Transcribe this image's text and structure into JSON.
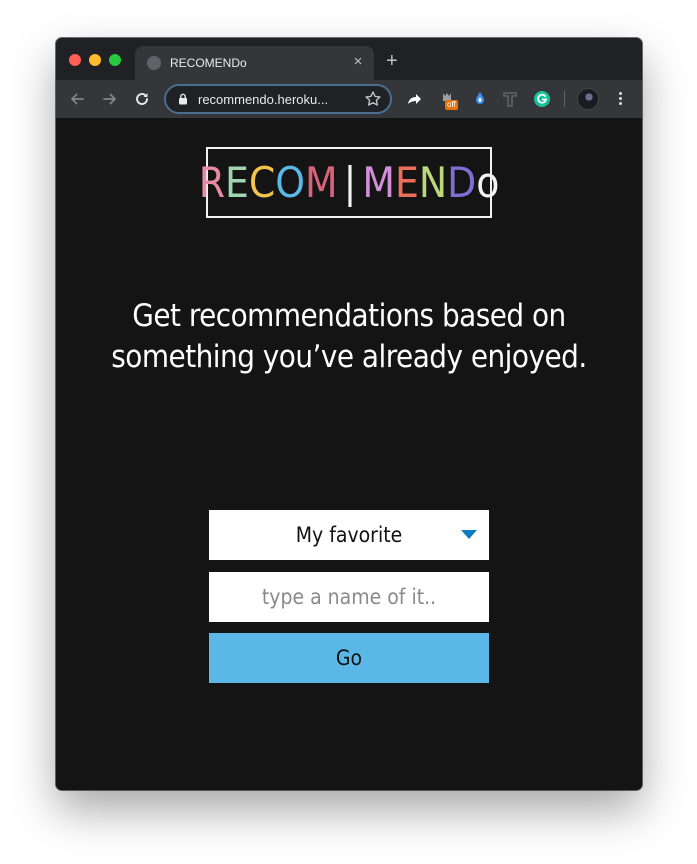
{
  "browser": {
    "tab_title": "RECOMENDo",
    "tab_close": "×",
    "new_tab": "+",
    "url": "recommendo.heroku...",
    "extension_badge": "off"
  },
  "logo": {
    "letters": [
      {
        "char": "R",
        "color": "#e88aa6"
      },
      {
        "char": "E",
        "color": "#9fd6b0"
      },
      {
        "char": "C",
        "color": "#f3c24b"
      },
      {
        "char": "O",
        "color": "#59b8e6"
      },
      {
        "char": "M",
        "color": "#d8627a"
      },
      {
        "char": "|",
        "color": "#f2f2f2"
      },
      {
        "char": "M",
        "color": "#d28ed8"
      },
      {
        "char": "E",
        "color": "#eb6e5b"
      },
      {
        "char": "N",
        "color": "#bcd67a"
      },
      {
        "char": "D",
        "color": "#7e6fd6"
      },
      {
        "char": "o",
        "color": "#f2f2f2"
      }
    ]
  },
  "main": {
    "tagline_line1": "Get recommendations based on",
    "tagline_line2": "something you’ve already enjoyed.",
    "category_select": "My favorite",
    "name_placeholder": "type a name of it..",
    "go_label": "Go"
  },
  "colors": {
    "background": "#141414",
    "go_button": "#5bb8e6",
    "caret": "#0c7abf"
  }
}
